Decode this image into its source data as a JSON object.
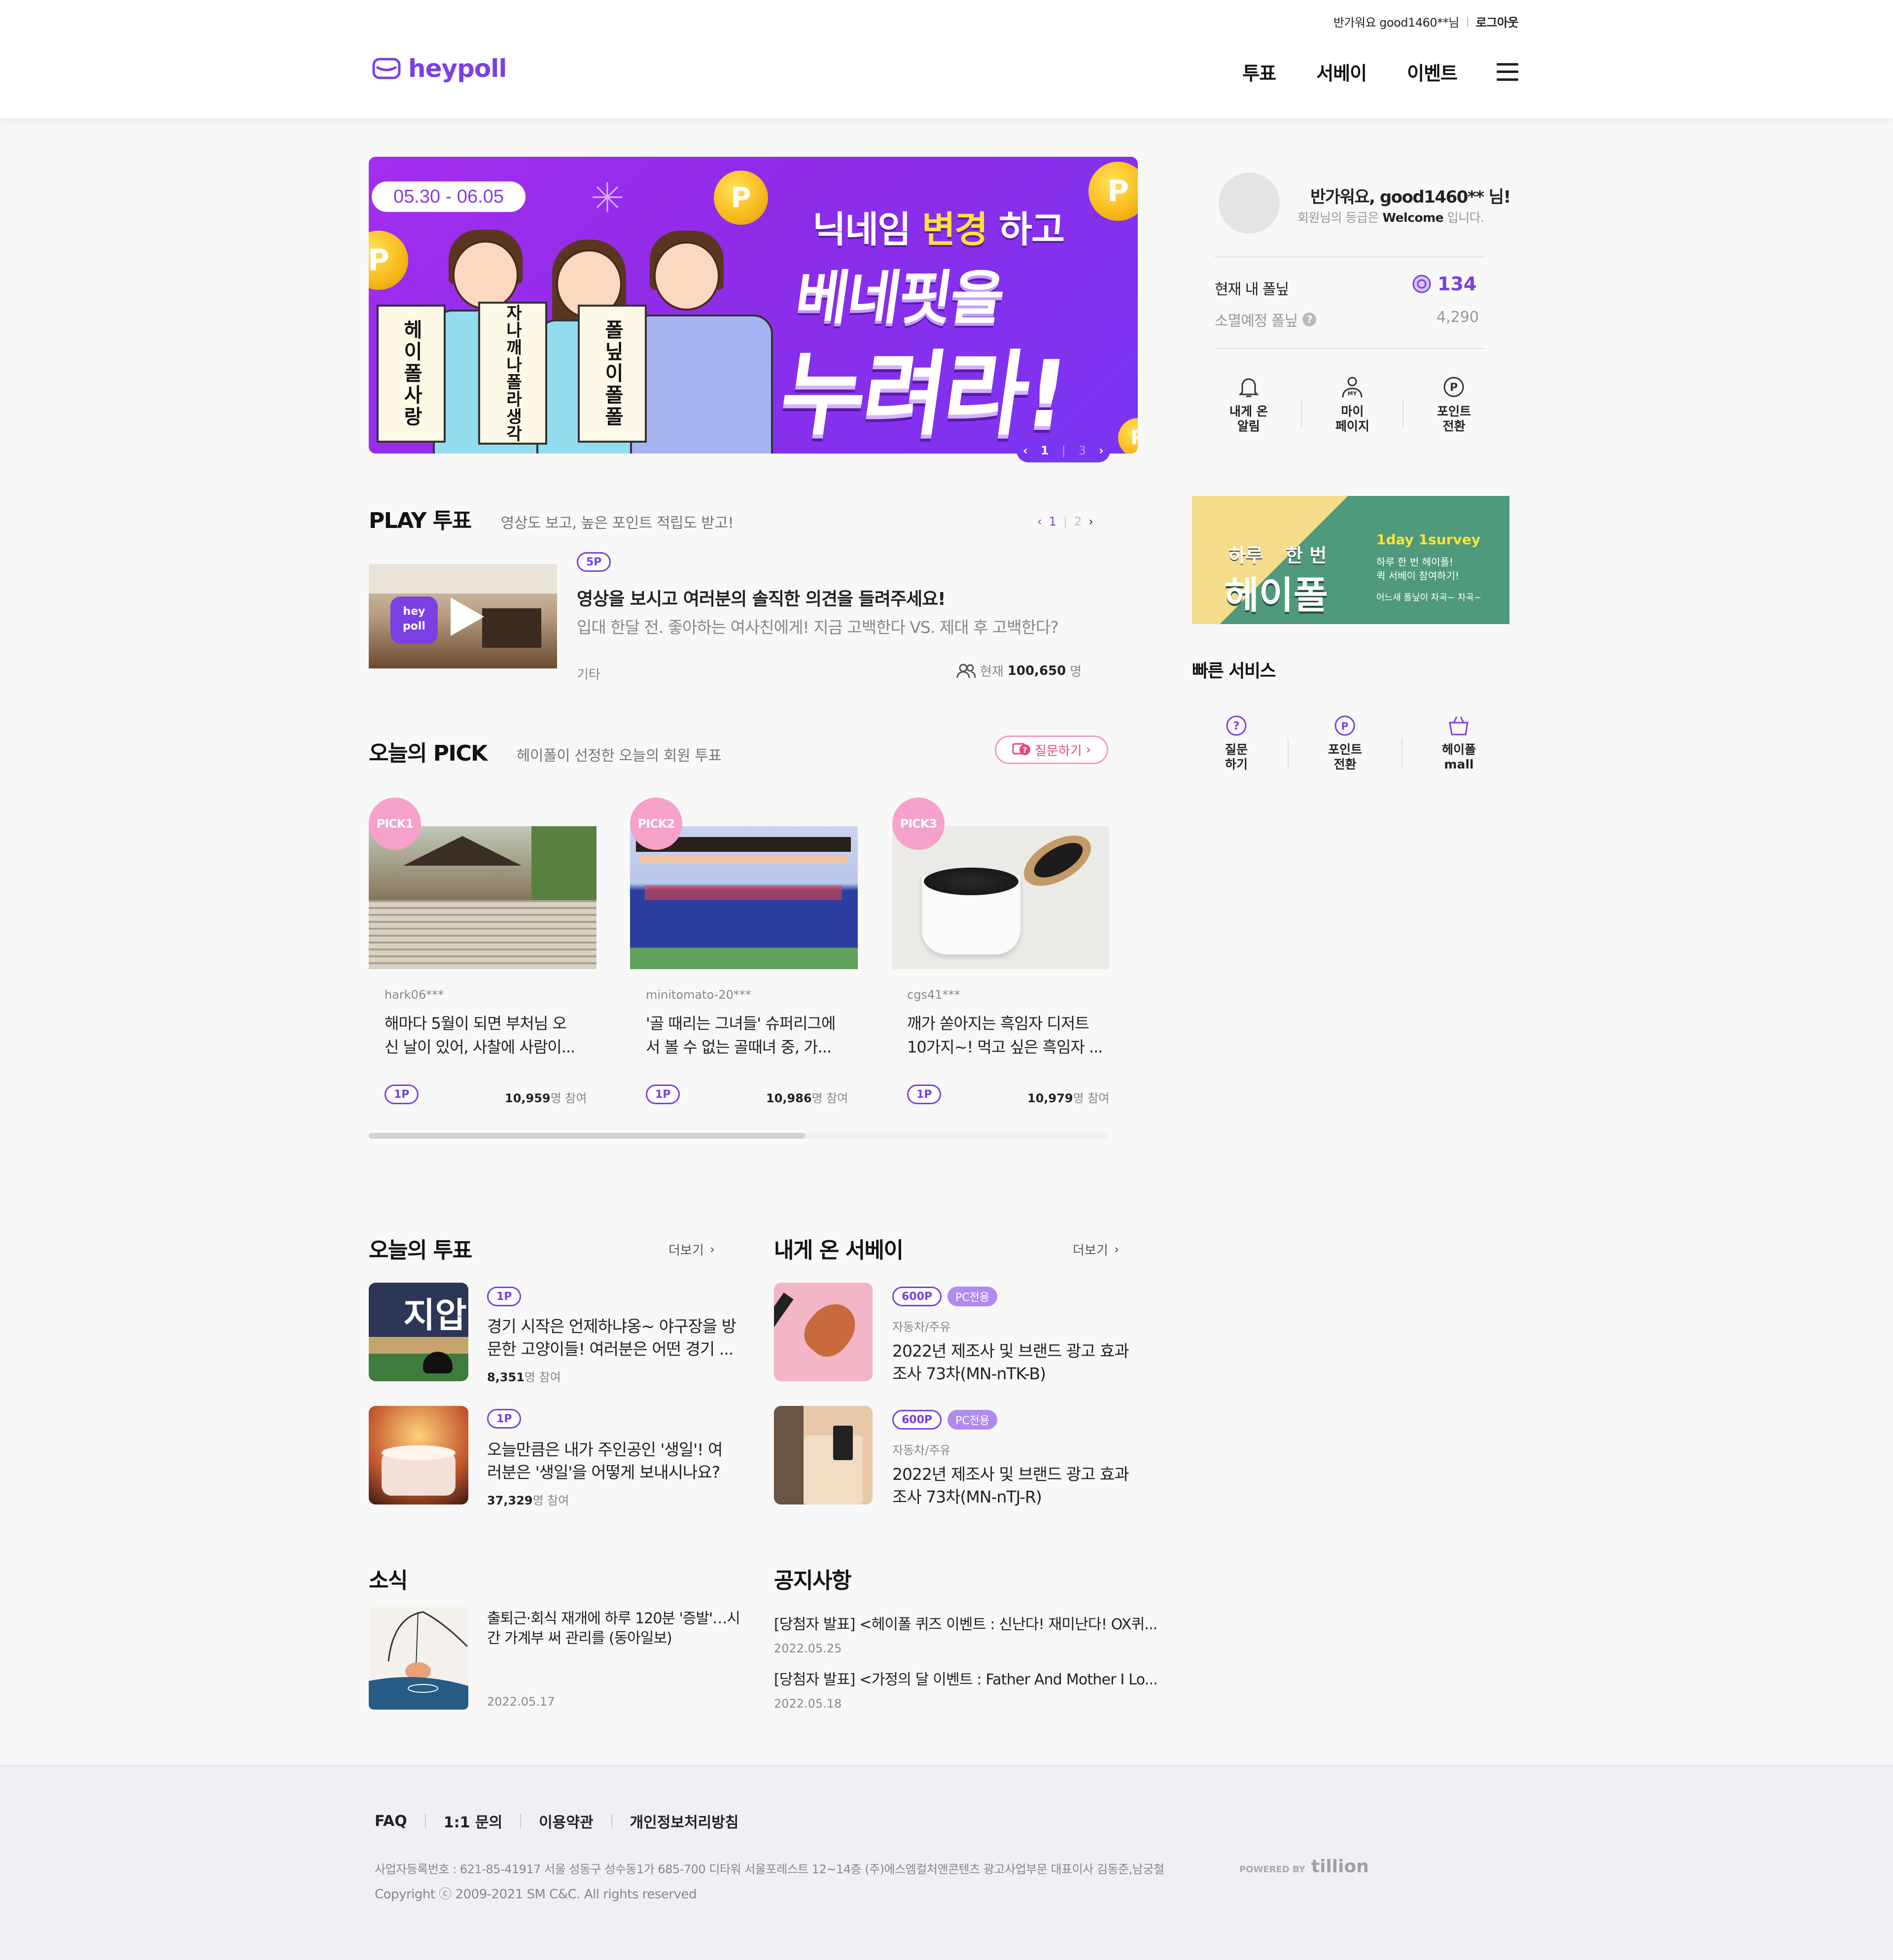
{
  "header": {
    "greeting": "반가워요 good1460**님",
    "logout": "로그아웃",
    "logo": "heypoll",
    "nav": [
      "투표",
      "서베이",
      "이벤트"
    ]
  },
  "banner": {
    "date": "05.30 - 06.05",
    "headline1_pre": "닉네임 ",
    "headline1_em": "변경",
    "headline1_post": " 하고",
    "headline2": "베네핏을",
    "headline3": "누려라!",
    "cards": [
      "헤이폴사랑",
      "자나깨나폴라생각",
      "폴닢이폴폴"
    ],
    "page_current": "1",
    "page_total": "3"
  },
  "play": {
    "title": "PLAY 투표",
    "subtitle": "영상도 보고, 높은 포인트 적립도 받고!",
    "page_current": "1",
    "page_total": "2",
    "item": {
      "badge": "5P",
      "title": "영상을 보시고 여러분의 솔직한 의견을 들려주세요!",
      "desc": "입대 한달 전. 좋아하는 여사친에게! 지금 고백한다 VS. 제대 후 고백한다?",
      "category": "기타",
      "current_label": "현재",
      "count": "100,650",
      "unit": "명",
      "thumb_logo": "hey poll"
    }
  },
  "pick": {
    "title": "오늘의 PICK",
    "subtitle": "헤이폴이 선정한 오늘의 회원 투표",
    "ask_button": "질문하기",
    "scroll_fraction": 0.59,
    "cards": [
      {
        "label": "PICK1",
        "author": "hark06***",
        "title1": "해마다 5월이 되면 부처님 오",
        "title2": "신 날이 있어, 사찰에 사람이...",
        "badge": "1P",
        "count": "10,959",
        "suffix": "명 참여"
      },
      {
        "label": "PICK2",
        "author": "minitomato-20***",
        "title1": "'골 때리는 그녀들' 슈퍼리그에",
        "title2": "서 볼 수 없는 골때녀 중, 가...",
        "badge": "1P",
        "count": "10,986",
        "suffix": "명 참여"
      },
      {
        "label": "PICK3",
        "author": "cgs41***",
        "title1": "깨가 쏟아지는 흑임자 디저트",
        "title2": "10가지~! 먹고 싶은 흑임자 ...",
        "badge": "1P",
        "count": "10,979",
        "suffix": "명 참여"
      }
    ]
  },
  "today_vote": {
    "title": "오늘의 투표",
    "more": "더보기",
    "items": [
      {
        "badge": "1P",
        "title1": "경기 시작은 언제하냐옹~ 야구장을 방",
        "title2": "문한 고양이들! 여러분은 어떤 경기 ...",
        "count": "8,351",
        "suffix": "명 참여",
        "thumb_text": "지압"
      },
      {
        "badge": "1P",
        "title1": "오늘만큼은 내가 주인공인 '생일'! 여",
        "title2": "러분은 '생일'을 어떻게 보내시나요?",
        "count": "37,329",
        "suffix": "명 참여"
      }
    ]
  },
  "survey": {
    "title": "내게 온 서베이",
    "more": "더보기",
    "items": [
      {
        "badge": "600P",
        "pc": "PC전용",
        "category": "자동차/주유",
        "title1": "2022년 제조사 및 브랜드 광고 효과",
        "title2": "조사 73차(MN-nTK-B)"
      },
      {
        "badge": "600P",
        "pc": "PC전용",
        "category": "자동차/주유",
        "title1": "2022년 제조사 및 브랜드 광고 효과",
        "title2": "조사 73차(MN-nTJ-R)"
      }
    ]
  },
  "news": {
    "title": "소식",
    "item": {
      "title1": "출퇴근·회식 재개에 하루 120분 '증발'…시",
      "title2": "간 가계부 써 관리를 (동아일보)",
      "date": "2022.05.17"
    }
  },
  "notice": {
    "title": "공지사항",
    "items": [
      {
        "title": "[당첨자 발표] <헤이폴 퀴즈 이벤트 : 신난다! 재미난다! OX퀴...",
        "date": "2022.05.25"
      },
      {
        "title": "[당첨자 발표] <가정의 달 이벤트 : Father And Mother I Lo...",
        "date": "2022.05.18"
      }
    ]
  },
  "sidebar": {
    "hello": "반가워요, good1460** 님!",
    "grade_pre": "회원님의 등급은 ",
    "grade": "Welcome",
    "grade_post": " 입니다.",
    "points_label": "현재 내 폴닢",
    "points": "134",
    "expire_label": "소멸예정 폴닢",
    "expire": "4,290",
    "menu": [
      {
        "l1": "내게 온",
        "l2": "알림"
      },
      {
        "l1": "마이",
        "l2": "페이지"
      },
      {
        "l1": "포인트",
        "l2": "전환"
      }
    ],
    "ad": {
      "left1": "하루",
      "left2": "한 번",
      "brand": "헤이폴",
      "right_title": "1day 1survey",
      "right1": "하루 한 번 헤이폴!",
      "right2": "퀵 서베이 참여하기!",
      "right3": "어느새 폴닢이 차곡~ 차곡~"
    },
    "quick_title": "빠른 서비스",
    "quick": [
      {
        "l1": "질문",
        "l2": "하기"
      },
      {
        "l1": "포인트",
        "l2": "전환"
      },
      {
        "l1": "헤이폴",
        "l2": "mall"
      }
    ]
  },
  "footer": {
    "links": [
      "FAQ",
      "1:1 문의",
      "이용약관",
      "개인정보처리방침"
    ],
    "address": "사업자등록번호 : 621-85-41917 서울 성동구 성수동1가 685-700 디타워 서울포레스트 12~14층 (주)에스엠컬처앤콘텐츠 광고사업부문 대표이사 김동준,남궁철",
    "powered": "POWERED BY",
    "powered_brand": "tillion",
    "copyright": "Copyright ⓒ 2009-2021 SM C&C. All rights reserved"
  },
  "colors": {
    "accent": "#7b3fe4",
    "pick": "#f5a1c9",
    "pc": "#b18af0",
    "ask": "#e8477e"
  }
}
